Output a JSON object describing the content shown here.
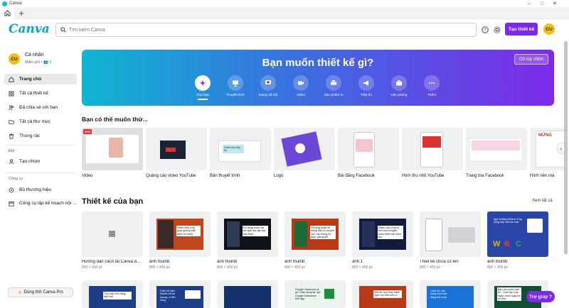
{
  "window": {
    "title": "Canva"
  },
  "topbar": {
    "brand": "Canva",
    "search_placeholder": "Tìm kiếm Canva",
    "create_label": "Tạo thiết kế",
    "avatar_initials": "CU"
  },
  "account": {
    "name": "Cá nhân",
    "plan": "Miễn phí • 👥 1",
    "initials": "CU"
  },
  "sidebar": {
    "items": [
      {
        "label": "Trang chủ"
      },
      {
        "label": "Tất cả thiết kế"
      },
      {
        "label": "Đã chia sẻ với bạn"
      },
      {
        "label": "Tất cả thư mục"
      },
      {
        "label": "Thùng rác"
      }
    ],
    "team_section": "Đội",
    "team_item": "Tạo nhóm",
    "tools_section": "Công cụ",
    "tools": [
      {
        "label": "Bộ thương hiệu"
      },
      {
        "label": "Công cụ lập kế hoạch nội ..."
      }
    ],
    "pro_label": "Dùng thử Canva Pro"
  },
  "hero": {
    "title": "Bạn muốn thiết kế gì?",
    "custom_size": "Cỡ tùy chỉnh",
    "categories": [
      {
        "label": "Cho bạn"
      },
      {
        "label": "Thuyết trình"
      },
      {
        "label": "Mạng xã hội"
      },
      {
        "label": "Video"
      },
      {
        "label": "Sản phẩm in"
      },
      {
        "label": "Tiếp thị"
      },
      {
        "label": "Văn phòng"
      },
      {
        "label": "Thêm"
      }
    ]
  },
  "suggest": {
    "title": "Bạn có thể muốn thử...",
    "badge": "MỚI",
    "items": [
      {
        "label": "Video"
      },
      {
        "label": "Quảng cáo video YouTube"
      },
      {
        "label": "Bản thuyết trình"
      },
      {
        "label": "Logo"
      },
      {
        "label": "Bài đăng Facebook"
      },
      {
        "label": "Hình thu nhỏ YouTube"
      },
      {
        "label": "Trang bìa Facebook"
      },
      {
        "label": "Hình nền má"
      }
    ],
    "thumb_texts": {
      "pres": "Chiến dịch tiếp thị",
      "cover": "MỪNG"
    }
  },
  "designs": {
    "title": "Thiết kế của bạn",
    "see_all": "Xem tất cả",
    "items": [
      {
        "name": "Hướng dẫn cách tải Canva đ...",
        "size": "800 × 450 px"
      },
      {
        "name": "ảnh thumb",
        "size": "800 × 450 px"
      },
      {
        "name": "ảnh thumb",
        "size": "800 × 450 px"
      },
      {
        "name": "ảnh thumb",
        "size": "800 × 450 px"
      },
      {
        "name": "ảnh 1",
        "size": "800 × 450 px"
      },
      {
        "name": "Thiết kế chưa có tên",
        "size": "800 × 450 px"
      },
      {
        "name": "ảnh thumb",
        "size": "800 × 450 px"
      }
    ],
    "thumb_texts": [
      "",
      "Nhiều hiệu ứng giúp gương mặt thêm tự nhiên",
      "Đổ dòng zoom sót kết quả học tập của bản thân",
      "Phương pháp hệ thống đầu tư chuyên sâu, các thông tin giúp, giải quyết",
      "Nhiều hiệu ứng cụ thể chọn chuyên, hoàn thiện việc kiến tạo",
      "",
      "App Writing Wizard: Ứng dụng hấp viết cho bạn."
    ],
    "row2_texts": [
      "Tích hợp tính năng hiện đại",
      "Cách tối hiệu Mobile bổ trợ phong, vì lắm cũng",
      "",
      "Google Classroom là gì? Cách dùng tài, lợp Google Classroom trên app",
      "Viết lợi, học thực hành nghe nói hiểu trên vi",
      "Cách tôi, xây dựng một hoạt động trên máy",
      "Bật Lam phiên bản tối - Tuần lập 3 lại ngay: chọn ngay khi nó trên",
      ""
    ]
  },
  "help": {
    "label": "Trợ giúp ?"
  }
}
